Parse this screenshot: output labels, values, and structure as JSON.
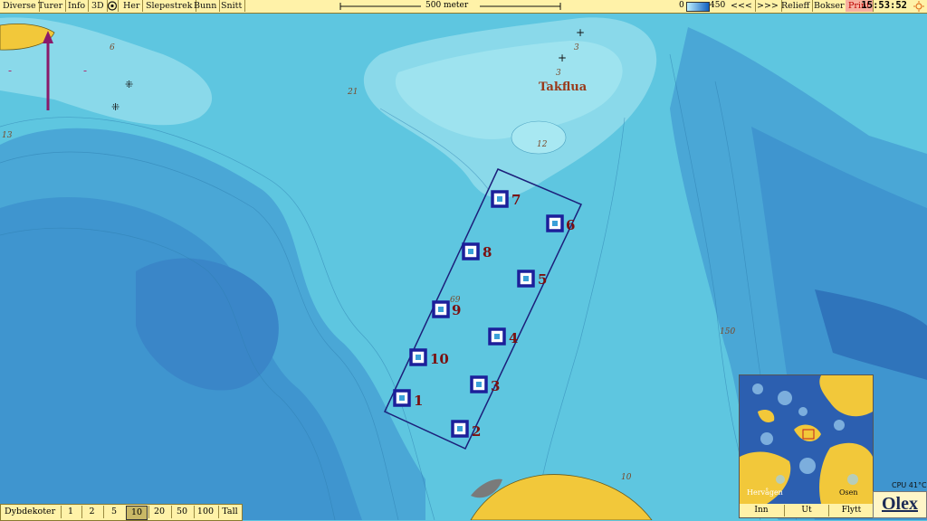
{
  "toolbar": {
    "menu": [
      "Diverse",
      "Turer",
      "Info",
      "3D",
      "Her",
      "Slepestrek",
      "Bunn",
      "Snitt"
    ],
    "scale_label": "500 meter",
    "depth_scale_min": "0",
    "depth_scale_max": "450",
    "back_label": "<<<",
    "forward_label": ">>>",
    "relief_label": "Relieff",
    "boxes_label": "Bokser",
    "print_label": "Print",
    "clock": "15:53:52"
  },
  "map": {
    "place_name": "Takflua",
    "depth_labels": [
      "6",
      "21",
      "12",
      "13",
      "69",
      "150",
      "10",
      "3",
      "3"
    ],
    "waypoints": [
      {
        "label": "1"
      },
      {
        "label": "2"
      },
      {
        "label": "3"
      },
      {
        "label": "4"
      },
      {
        "label": "5"
      },
      {
        "label": "6"
      },
      {
        "label": "7"
      },
      {
        "label": "8"
      },
      {
        "label": "9"
      },
      {
        "label": "10"
      }
    ]
  },
  "bottom_bar": {
    "label": "Dybdekoter",
    "options": [
      "1",
      "2",
      "5",
      "10",
      "20",
      "50",
      "100",
      "Tall"
    ],
    "selected": "10"
  },
  "minimap": {
    "buttons": [
      "Inn",
      "Ut",
      "Flytt"
    ],
    "place_labels": [
      "Hervågen",
      "Osen"
    ]
  },
  "status": {
    "cpu": "CPU 41°C"
  },
  "logo": "Olex",
  "colors": {
    "deep_water": "#3e8fd0",
    "mid_water": "#5ec6e0",
    "shallow_water": "#9ee3ef",
    "land": "#f2c83a",
    "boundary": "#1c1f7a",
    "waypoint_label": "#7a1010",
    "toolbar": "#fff2a8"
  }
}
